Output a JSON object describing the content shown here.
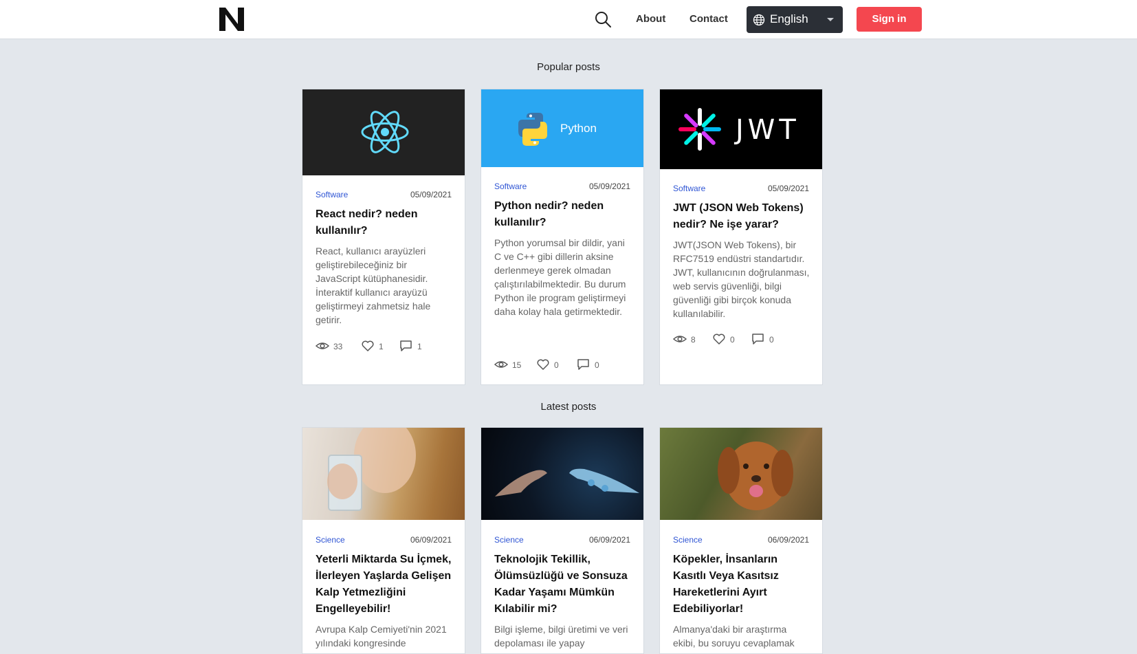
{
  "header": {
    "logo_letter": "N",
    "nav": {
      "about": "About",
      "contact": "Contact"
    },
    "language": {
      "selected": "English"
    },
    "signin_label": "Sign in"
  },
  "sections": {
    "popular_title": "Popular posts",
    "latest_title": "Latest posts"
  },
  "popular_posts": [
    {
      "image": "react-logo",
      "category": "Software",
      "date": "05/09/2021",
      "title": "React nedir? neden kullanılır?",
      "excerpt": "React, kullanıcı arayüzleri geliştirebileceğiniz bir JavaScript kütüphanesidir. İnteraktif kullanıcı arayüzü geliştirmeyi zahmetsiz hale getirir.",
      "views": "33",
      "likes": "1",
      "comments": "1"
    },
    {
      "image": "python-logo",
      "image_text": "Python",
      "category": "Software",
      "date": "05/09/2021",
      "title": "Python nedir? neden kullanılır?",
      "excerpt": "Python yorumsal bir dildir, yani C ve C++ gibi dillerin aksine derlenmeye gerek olmadan çalıştırılabilmektedir. Bu durum Python ile program geliştirmeyi daha kolay hala getirmektedir.",
      "views": "15",
      "likes": "0",
      "comments": "0"
    },
    {
      "image": "jwt-logo",
      "image_text": "JWT",
      "category": "Software",
      "date": "05/09/2021",
      "title": "JWT (JSON Web Tokens) nedir? Ne işe yarar?",
      "excerpt": "JWT(JSON Web Tokens), bir RFC7519 endüstri standartıdır. JWT, kullanıcının doğrulanması, web servis güvenliği, bilgi güvenliği gibi birçok konuda kullanılabilir.",
      "views": "8",
      "likes": "0",
      "comments": "0"
    }
  ],
  "latest_posts": [
    {
      "image": "woman-drinking-water-photo",
      "category": "Science",
      "date": "06/09/2021",
      "title": "Yeterli Miktarda Su İçmek, İlerleyen Yaşlarda Gelişen Kalp Yetmezliğini Engelleyebilir!",
      "excerpt": "Avrupa Kalp Cemiyeti'nin 2021 yılındaki kongresinde"
    },
    {
      "image": "human-robot-hands-photo",
      "category": "Science",
      "date": "06/09/2021",
      "title": "Teknolojik Tekillik, Ölümsüzlüğü ve Sonsuza Kadar Yaşamı Mümkün Kılabilir mi?",
      "excerpt": "Bilgi işleme, bilgi üretimi ve veri depolaması ile yapay"
    },
    {
      "image": "dog-photo",
      "category": "Science",
      "date": "06/09/2021",
      "title": "Köpekler, İnsanların Kasıtlı Veya Kasıtsız Hareketlerini Ayırt Edebiliyorlar!",
      "excerpt": "Almanya'daki bir araştırma ekibi, bu soruyu cevaplamak"
    }
  ],
  "colors": {
    "page_bg": "#e3e7ec",
    "accent_blue": "#2f55d4",
    "signin_red": "#f4474f",
    "lang_bg": "#2b2f36",
    "python_bg": "#2aa7f2"
  }
}
